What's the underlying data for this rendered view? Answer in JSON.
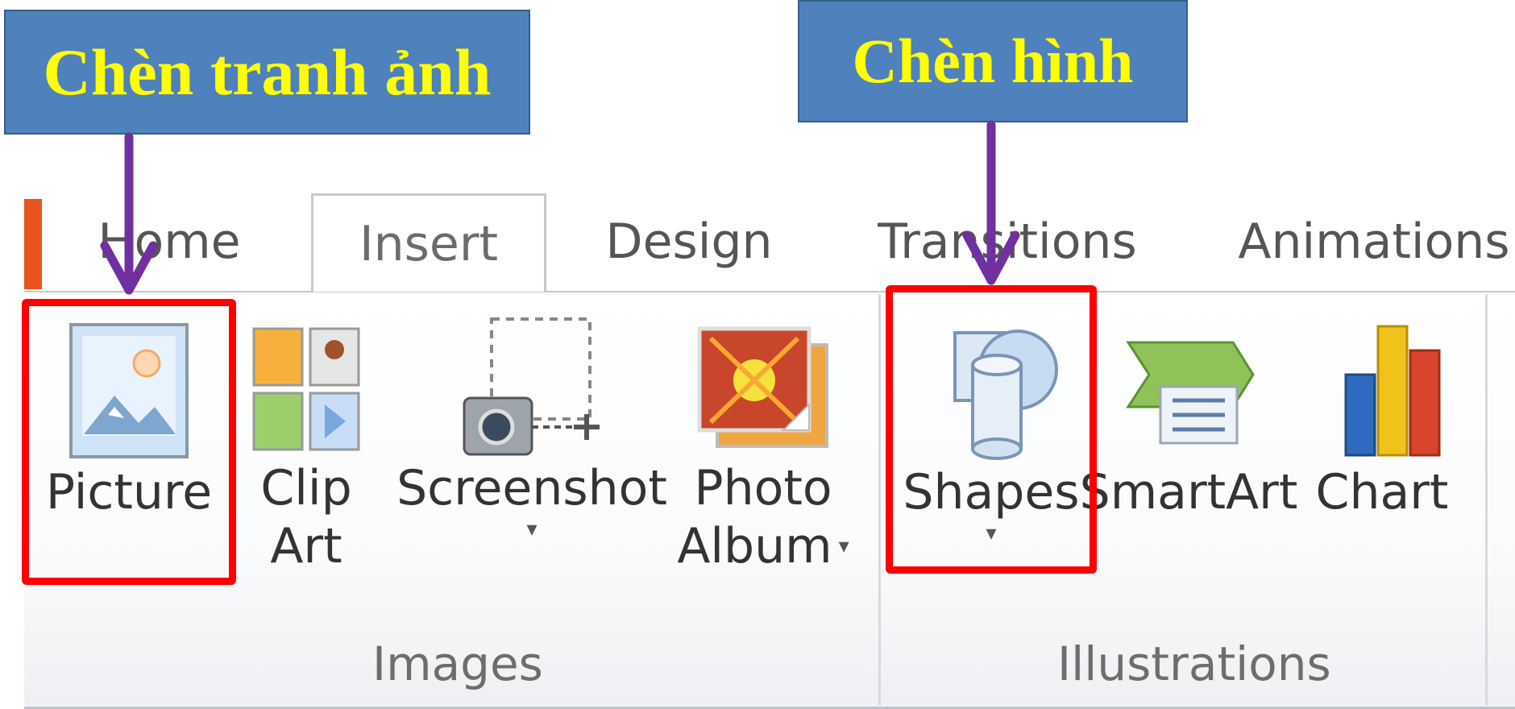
{
  "annotations": {
    "left_callout": "Chèn tranh ảnh",
    "right_callout": "Chèn hình"
  },
  "tabs": [
    "Home",
    "Insert",
    "Design",
    "Transitions",
    "Animations"
  ],
  "active_tab": "Insert",
  "groups": {
    "images": {
      "label": "Images",
      "commands": {
        "picture": {
          "label": "Picture"
        },
        "clip_art": {
          "line1": "Clip",
          "line2": "Art"
        },
        "screenshot": {
          "label": "Screenshot",
          "arrow": "▾"
        },
        "photo_album": {
          "line1": "Photo",
          "line2": "Album",
          "arrow": "▾"
        }
      }
    },
    "illustrations": {
      "label": "Illustrations",
      "commands": {
        "shapes": {
          "label": "Shapes",
          "arrow": "▾"
        },
        "smartart": {
          "label": "SmartArt"
        },
        "chart": {
          "label": "Chart"
        }
      }
    }
  },
  "colors": {
    "callout_bg": "#4f81bd",
    "callout_text": "#ffff00",
    "highlight": "#ff0000",
    "arrow": "#7030a0"
  },
  "icons": [
    "picture-icon",
    "clip-art-icon",
    "screenshot-icon",
    "photo-album-icon",
    "shapes-icon",
    "smartart-icon",
    "chart-icon"
  ]
}
